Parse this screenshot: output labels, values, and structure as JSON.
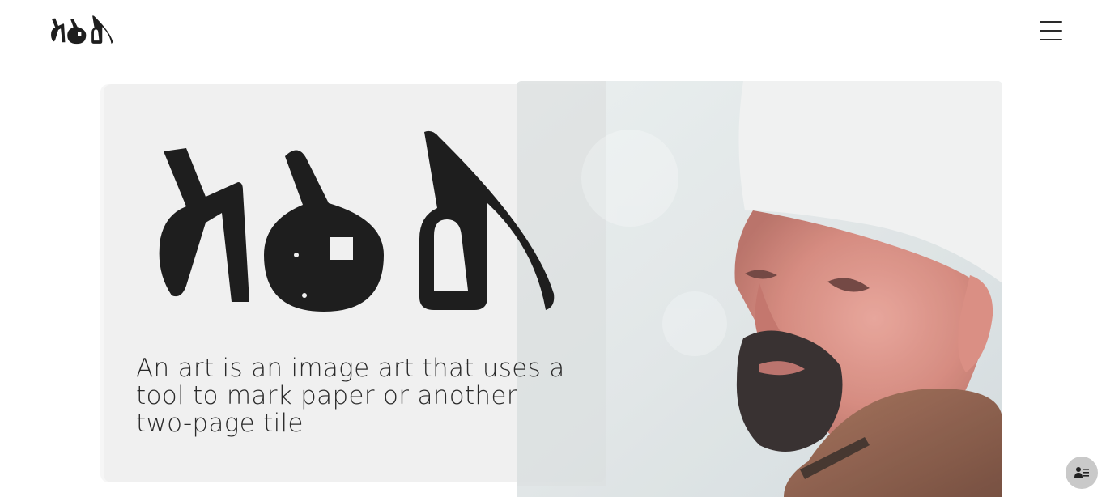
{
  "header": {
    "logo_icon": "brand-logo-icon",
    "menu_icon": "hamburger-menu-icon"
  },
  "hero": {
    "description": "An art is an image art that uses a tool to mark paper or another two-page tile"
  },
  "portrait": {
    "icon": "portrait-illustration"
  },
  "floating": {
    "accessibility_icon": "accessibility-person-list-icon"
  },
  "colors": {
    "ink": "#1e1e1e",
    "card": "#f0f0f0",
    "float_button": "#c9c9c9"
  }
}
